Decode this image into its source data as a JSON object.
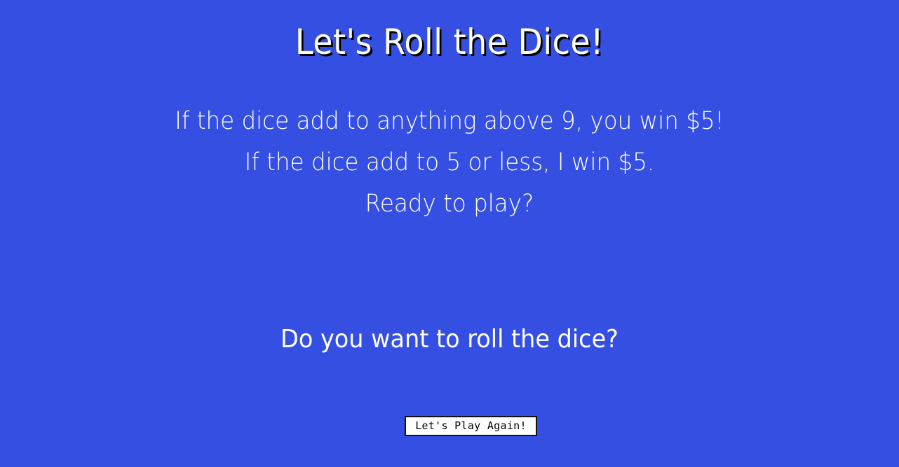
{
  "header": {
    "title": "Let's Roll the Dice!"
  },
  "rules": {
    "line1": "If the dice add to anything above 9, you win $5!",
    "line2": "If the dice add to 5 or less, I win $5.",
    "line3": "Ready to play?"
  },
  "prompt": {
    "question": "Do you want to roll the dice?"
  },
  "actions": {
    "play_again_label": "Let's Play Again!"
  },
  "colors": {
    "background": "#354fe2",
    "text": "#ffffff",
    "title_shadow": "#000000"
  }
}
